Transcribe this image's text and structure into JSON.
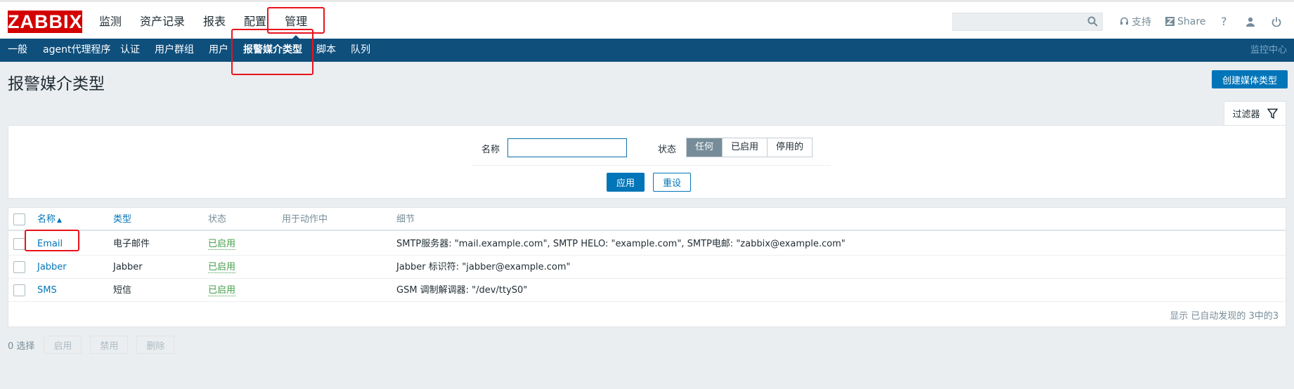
{
  "app": {
    "logo": "ZABBIX"
  },
  "main_menu": [
    {
      "label": "监测"
    },
    {
      "label": "资产记录"
    },
    {
      "label": "报表"
    },
    {
      "label": "配置"
    },
    {
      "label": "管理",
      "selected": true
    }
  ],
  "header_tools": {
    "search_placeholder": "",
    "support_label": "支持",
    "share_label": "Share",
    "help_label": "?"
  },
  "sub_menu": [
    {
      "label": "一般"
    },
    {
      "label": "agent代理程序"
    },
    {
      "label": "认证"
    },
    {
      "label": "用户群组"
    },
    {
      "label": "用户"
    },
    {
      "label": "报警媒介类型",
      "active": true
    },
    {
      "label": "脚本"
    },
    {
      "label": "队列"
    }
  ],
  "kiosk_label": "监控中心",
  "page": {
    "title": "报警媒介类型",
    "create_button": "创建媒体类型"
  },
  "filter": {
    "tab_label": "过滤器",
    "name_label": "名称",
    "name_value": "",
    "status_label": "状态",
    "status_options": [
      "任何",
      "已启用",
      "停用的"
    ],
    "status_selected": "任何",
    "apply_button": "应用",
    "reset_button": "重设"
  },
  "table": {
    "columns": {
      "name": "名称",
      "sort_indicator": "▲",
      "type": "类型",
      "status": "状态",
      "used_in_actions": "用于动作中",
      "details": "细节"
    },
    "rows": [
      {
        "name": "Email",
        "type": "电子邮件",
        "status": "已启用",
        "used": "",
        "details": "SMTP服务器: \"mail.example.com\", SMTP HELO: \"example.com\", SMTP电邮: \"zabbix@example.com\""
      },
      {
        "name": "Jabber",
        "type": "Jabber",
        "status": "已启用",
        "used": "",
        "details": "Jabber 标识符: \"jabber@example.com\""
      },
      {
        "name": "SMS",
        "type": "短信",
        "status": "已启用",
        "used": "",
        "details": "GSM 调制解调器: \"/dev/ttyS0\""
      }
    ],
    "footer": "显示 已自动发现的 3中的3"
  },
  "mass_actions": {
    "selected_count": "0 选择",
    "enable": "启用",
    "disable": "禁用",
    "delete": "删除"
  },
  "colors": {
    "brand_red": "#d40000",
    "nav_blue": "#0e4f7c",
    "link_blue": "#0275b8",
    "enabled_green": "#429e47",
    "highlight_red": "#e8141c"
  }
}
